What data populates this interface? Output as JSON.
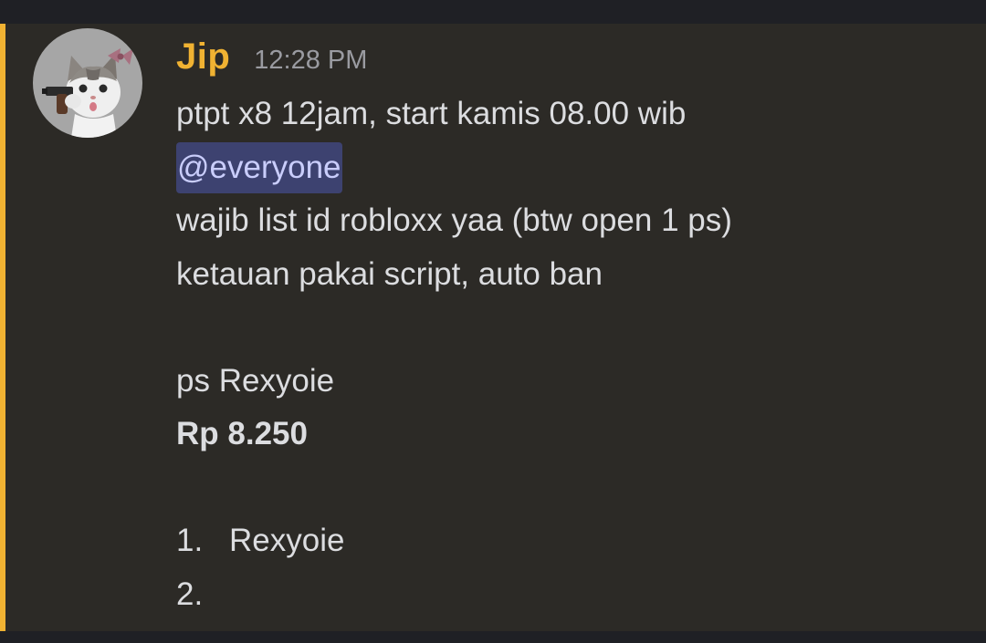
{
  "message": {
    "author": "Jip",
    "timestamp": "12:28 PM",
    "avatar": "cat-with-gun-avatar",
    "accent_color": "#f0b232",
    "mention_color": "#3d4270",
    "lines": {
      "l1": "ptpt x8 12jam, start kamis 08.00 wib",
      "mention": "@everyone",
      "l3": "wajib list id robloxx yaa (btw open 1 ps)",
      "l4": "ketauan pakai script, auto ban",
      "l6": "ps Rexyoie",
      "price": "Rp 8.250"
    },
    "list": [
      {
        "num": "1.",
        "text": "Rexyoie"
      },
      {
        "num": "2.",
        "text": ""
      }
    ]
  }
}
